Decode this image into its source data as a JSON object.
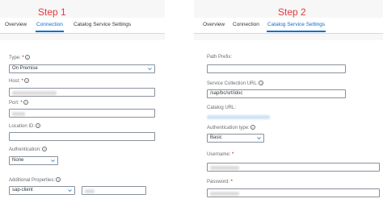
{
  "left": {
    "step_label": "Step 1",
    "tabs": [
      {
        "label": "Overview",
        "active": false
      },
      {
        "label": "Connection",
        "active": true
      },
      {
        "label": "Catalog Service Settings",
        "active": false
      }
    ],
    "type": {
      "label": "Type:",
      "value": "On Premise"
    },
    "host": {
      "label": "Host:"
    },
    "port": {
      "label": "Port:"
    },
    "location_id": {
      "label": "Location ID:"
    },
    "authentication": {
      "label": "Authentication:",
      "value": "None"
    },
    "additional_properties": {
      "label": "Additional Properties:",
      "key_value": "sap-client"
    }
  },
  "right": {
    "step_label": "Step 2",
    "tabs": [
      {
        "label": "Overview",
        "active": false
      },
      {
        "label": "Connection",
        "active": false
      },
      {
        "label": "Catalog Service Settings",
        "active": true
      }
    ],
    "path_prefix": {
      "label": "Path Prefix:"
    },
    "service_collection_url": {
      "label": "Service Collection URL:",
      "value": "/sap/bc/srt/idoc"
    },
    "catalog_url": {
      "label": "Catalog URL:"
    },
    "authentication_type": {
      "label": "Authentication type:",
      "value": "Basic"
    },
    "username": {
      "label": "Username:"
    },
    "password": {
      "label": "Password:"
    }
  },
  "colors": {
    "accent": "#0a6ed1",
    "step": "#e8383d",
    "required": "#bb0000"
  }
}
